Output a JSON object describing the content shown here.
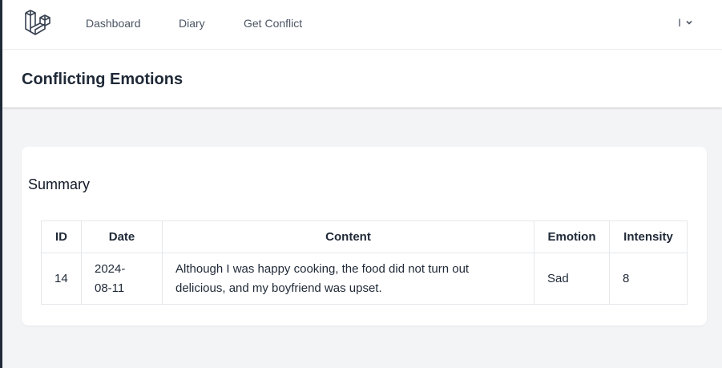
{
  "nav": {
    "links": [
      "Dashboard",
      "Diary",
      "Get Conflict"
    ],
    "user_name": "I",
    "dropdown_icon": "chevron-down-icon",
    "logo_icon": "laravel-logo-icon"
  },
  "header": {
    "title": "Conflicting Emotions"
  },
  "summary": {
    "title": "Summary",
    "columns": [
      "ID",
      "Date",
      "Content",
      "Emotion",
      "Intensity"
    ],
    "rows": [
      {
        "id": "14",
        "date": "2024-08-11",
        "content": "Although I was happy cooking, the food did not turn out delicious, and my boyfriend was upset.",
        "emotion": "Sad",
        "intensity": "8"
      }
    ]
  },
  "colors": {
    "accent_dark": "#1e2a38",
    "page_bg": "#f3f4f6",
    "border": "#e5e7eb"
  }
}
